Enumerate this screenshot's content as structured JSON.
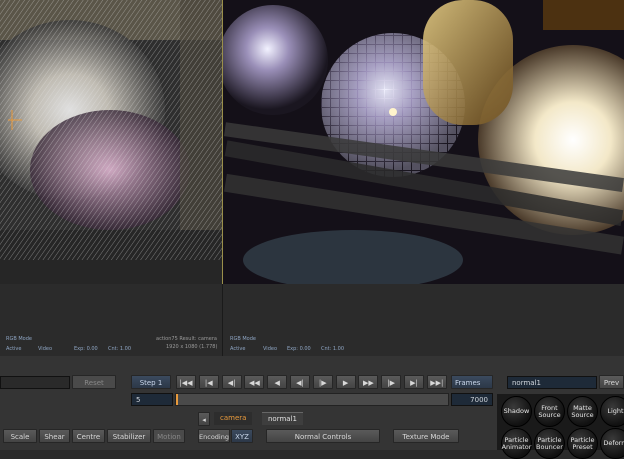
{
  "viewer_left": {
    "mode": "RGB Mode",
    "status_items": [
      "Active",
      "Video",
      "Exp: 0.00",
      "Cnt: 1.00"
    ],
    "result_label": "action75 Result: camera",
    "resolution": "1920 x 1080 (1.778)"
  },
  "viewer_right": {
    "mode": "RGB Mode",
    "status_items": [
      "Active",
      "Video",
      "Exp: 0.00",
      "Cnt: 1.00"
    ]
  },
  "controls": {
    "reset_label": "Reset",
    "step_label": "Step 1",
    "frame_value": "5",
    "frames_label": "Frames",
    "end_frame": "7000",
    "transport_icons": [
      "skip-to-start-icon",
      "previous-keyframe-icon",
      "step-back-to-mark-icon",
      "step-back-fast-icon",
      "step-back-icon",
      "play-backward-icon",
      "pause-icon",
      "play-forward-icon",
      "step-forward-fast-icon",
      "step-forward-to-mark-icon",
      "next-keyframe-icon",
      "skip-to-end-icon"
    ],
    "transport_glyphs": [
      "|◀◀",
      "|◀",
      "◀|",
      "◀◀",
      "◀",
      "◀|",
      "|▶",
      "▶",
      "▶▶",
      "|▶",
      "▶|",
      "▶▶|"
    ],
    "node_name": "normal1",
    "prev_label": "Prev",
    "scale_label": "Scale",
    "shear_label": "Shear",
    "centre_label": "Centre",
    "stabilizer_label": "Stabilizer",
    "motion_label": "Motion",
    "encoding_label": "Encoding",
    "xyz_label": "XYZ",
    "normal_controls_label": "Normal Controls",
    "texture_mode_label": "Texture Mode",
    "tab_camera": "camera",
    "tab_normal": "normal1"
  },
  "tools": {
    "row1": [
      "Shadow",
      "Front Source",
      "Matte Source",
      "Light"
    ],
    "row2": [
      "Particle Animator",
      "Particle Bouncer",
      "Particle Preset",
      "Deform"
    ]
  },
  "colors": {
    "accent_orange": "#e89a3c",
    "highlight_yellow": "#9a8f4a",
    "panel_blue": "#2c3848"
  }
}
